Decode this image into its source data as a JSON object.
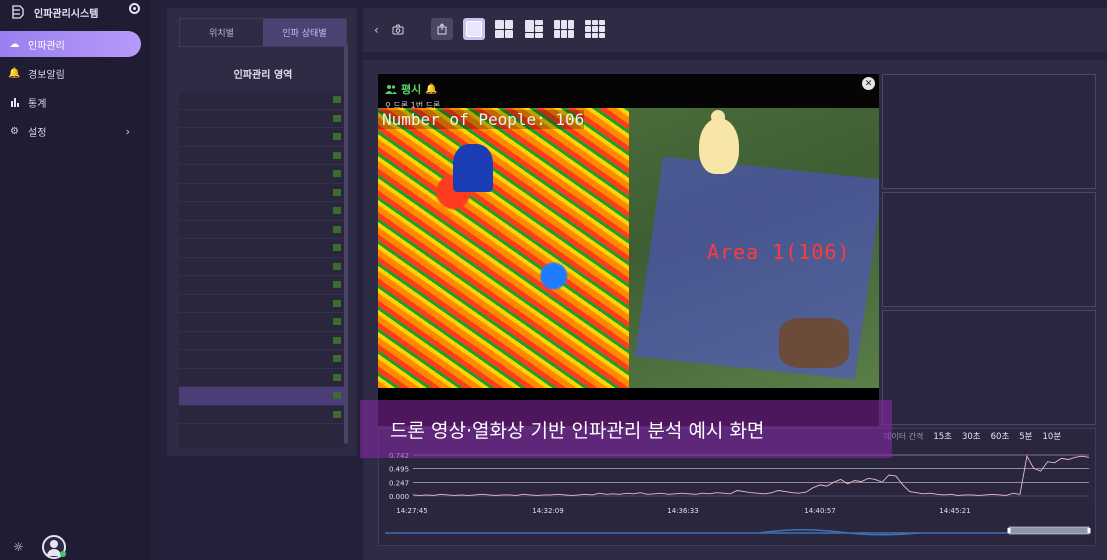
{
  "nav": {
    "title": "인파관리시스템",
    "items": [
      {
        "label": "인파관리",
        "icon": "cloud-icon",
        "active": true
      },
      {
        "label": "경보알림",
        "icon": "bell-icon",
        "active": false
      },
      {
        "label": "통계",
        "icon": "bar-chart-icon",
        "active": false
      },
      {
        "label": "설정",
        "icon": "gear-icon",
        "active": false
      }
    ]
  },
  "panel": {
    "tabs": [
      {
        "label": "위치별",
        "active": false
      },
      {
        "label": "인파 상태별",
        "active": true
      }
    ],
    "title": "인파관리 영역"
  },
  "video": {
    "status_label": "평시",
    "location_label": "드론 1번 드론",
    "people_count_text": "Number of People: 106",
    "area_label": "Area 1(106)"
  },
  "caption": "드론 영상·열화상 기반 인파관리 분석 예시 화면",
  "chart_controls": {
    "label": "데이터 간격",
    "options": [
      "15초",
      "30초",
      "60초",
      "5분",
      "10분"
    ]
  },
  "chart_data": {
    "type": "line",
    "y_ticks": [
      "0.742",
      "0.495",
      "0.247",
      "0.000"
    ],
    "ylim": [
      0,
      0.742
    ],
    "x_ticks": [
      "14:27:45",
      "14:32:09",
      "14:36:33",
      "14:40:57",
      "14:45:21"
    ],
    "series": [
      {
        "values": [
          0.02,
          0.01,
          0.02,
          0.01,
          0.03,
          0.02,
          0.01,
          0.02,
          0.01,
          0.02,
          0.03,
          0.02,
          0.01,
          0.02,
          0.02,
          0.01,
          0.03,
          0.02,
          0.01,
          0.02,
          0.02,
          0.03,
          0.02,
          0.01,
          0.02,
          0.03,
          0.02,
          0.05,
          0.03,
          0.04,
          0.03,
          0.05,
          0.04,
          0.06,
          0.03,
          0.04,
          0.05,
          0.03,
          0.04,
          0.05,
          0.04,
          0.03,
          0.05,
          0.04,
          0.06,
          0.05,
          0.04,
          0.1,
          0.08,
          0.06,
          0.05,
          0.04,
          0.06,
          0.1,
          0.08,
          0.06,
          0.05,
          0.07,
          0.15,
          0.2,
          0.18,
          0.25,
          0.3,
          0.22,
          0.28,
          0.26,
          0.32,
          0.3,
          0.25,
          0.38,
          0.36,
          0.2,
          0.08,
          0.06,
          0.04,
          0.05,
          0.03,
          0.02,
          0.03,
          0.01,
          0.02,
          0.02,
          0.01,
          0.02,
          0.03,
          0.02,
          0.01,
          0.05,
          0.03,
          0.72,
          0.5,
          0.45,
          0.62,
          0.6,
          0.68,
          0.66,
          0.7,
          0.72,
          0.7
        ]
      }
    ]
  }
}
